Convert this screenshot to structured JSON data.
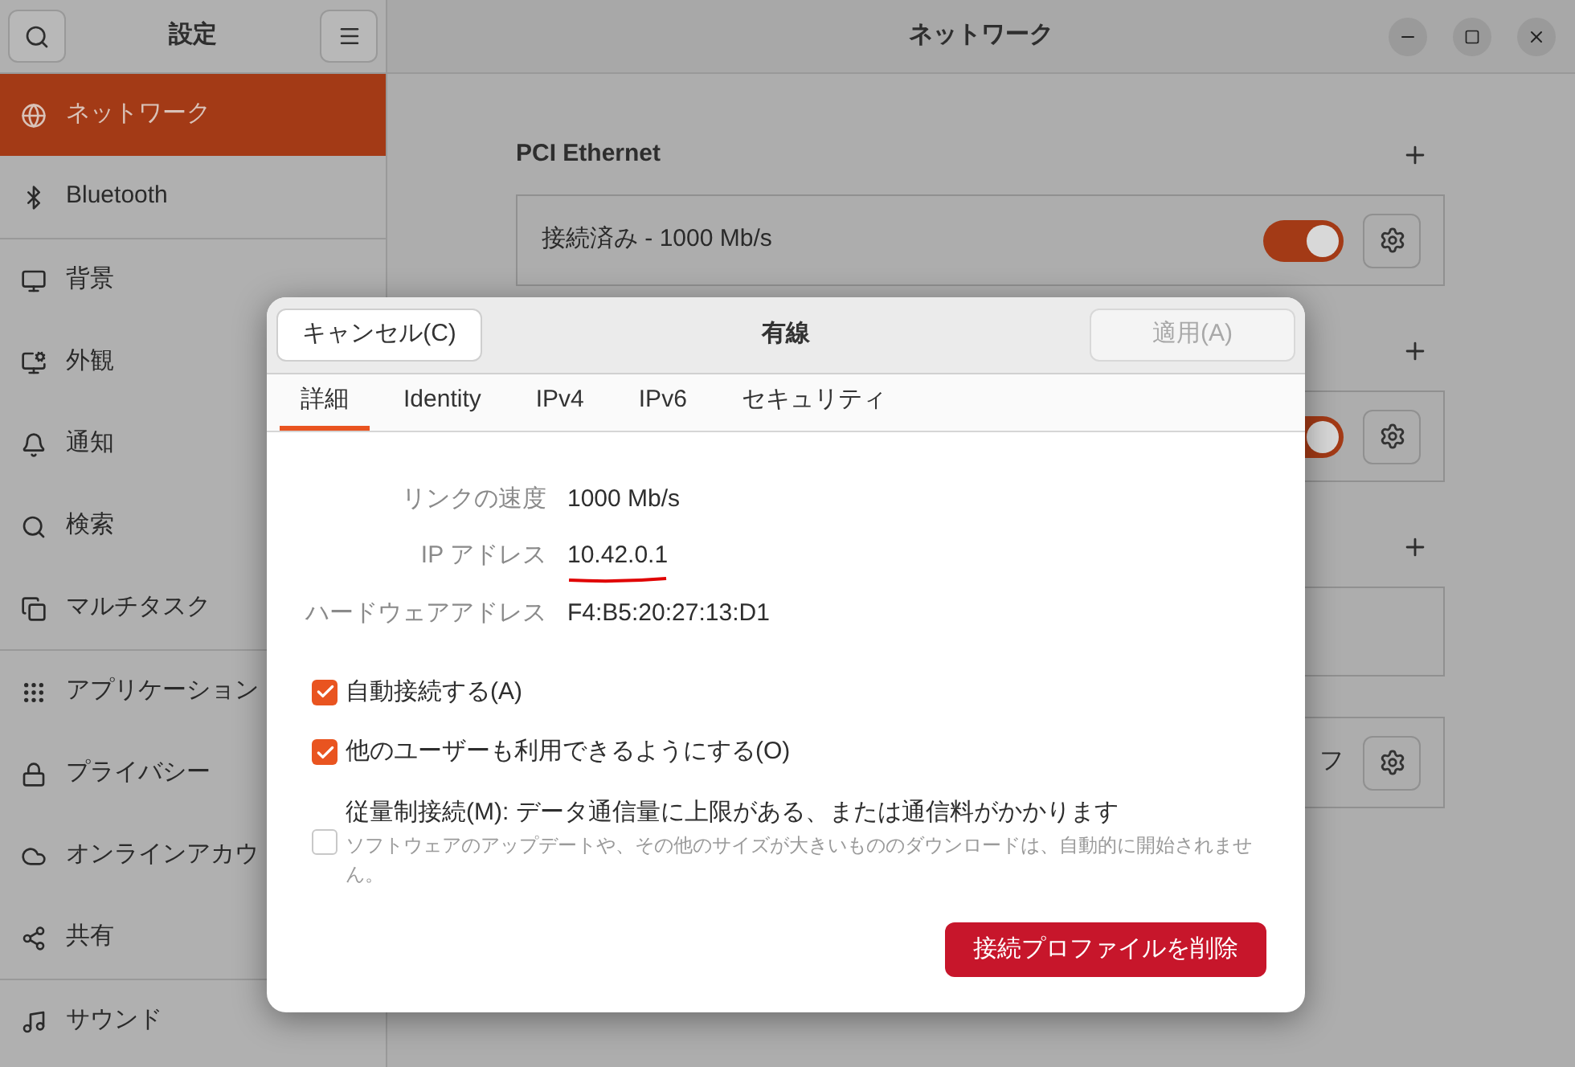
{
  "sidebar": {
    "title": "設定",
    "groups": [
      {
        "items": [
          {
            "label": "ネットワーク",
            "selected": true
          },
          {
            "label": "Bluetooth",
            "selected": false
          }
        ]
      },
      {
        "items": [
          {
            "label": "背景",
            "selected": false
          },
          {
            "label": "外観",
            "selected": false
          },
          {
            "label": "通知",
            "selected": false
          },
          {
            "label": "検索",
            "selected": false
          },
          {
            "label": "マルチタスク",
            "selected": false
          }
        ]
      },
      {
        "items": [
          {
            "label": "アプリケーション",
            "selected": false
          },
          {
            "label": "プライバシー",
            "selected": false
          },
          {
            "label": "オンラインアカウ",
            "selected": false
          },
          {
            "label": "共有",
            "selected": false
          }
        ]
      },
      {
        "items": [
          {
            "label": "サウンド",
            "selected": false
          }
        ]
      }
    ]
  },
  "window": {
    "title": "ネットワーク"
  },
  "sections": [
    {
      "title": "PCI Ethernet",
      "rows": [
        {
          "kind": "connection",
          "status": "接続済み - 1000 Mb/s",
          "on": true
        }
      ]
    },
    {
      "rows": [
        {
          "kind": "connection",
          "on": true
        }
      ]
    },
    {
      "rows": [
        {
          "kind": "empty"
        },
        {
          "kind": "connection",
          "status": "フ"
        }
      ]
    }
  ],
  "dialog": {
    "title": "有線",
    "header_buttons": [
      {
        "label": "キャンセル(C)",
        "disabled": false
      },
      {
        "label": "適用(A)",
        "disabled": true
      }
    ],
    "tabs": [
      {
        "label": "詳細",
        "selected": true
      },
      {
        "label": "Identity",
        "selected": false
      },
      {
        "label": "IPv4",
        "selected": false
      },
      {
        "label": "IPv6",
        "selected": false
      },
      {
        "label": "セキュリティ",
        "selected": false
      }
    ],
    "details": [
      {
        "label": "リンクの速度",
        "value": "1000 Mb/s",
        "underlined": false
      },
      {
        "label": "IP アドレス",
        "value": "10.42.0.1",
        "underlined": true
      },
      {
        "label": "ハードウェアアドレス",
        "value": "F4:B5:20:27:13:D1",
        "underlined": false
      }
    ],
    "options": [
      {
        "label": "自動接続する(A)",
        "checked": true
      },
      {
        "label": "他のユーザーも利用できるようにする(O)",
        "checked": true
      },
      {
        "label": "従量制接続(M): データ通信量に上限がある、または通信料がかかります",
        "description": "ソフトウェアのアップデートや、その他のサイズが大きいもののダウンロードは、自動的に開始されません。",
        "checked": false
      }
    ],
    "delete_button": "接続プロファイルを削除"
  }
}
